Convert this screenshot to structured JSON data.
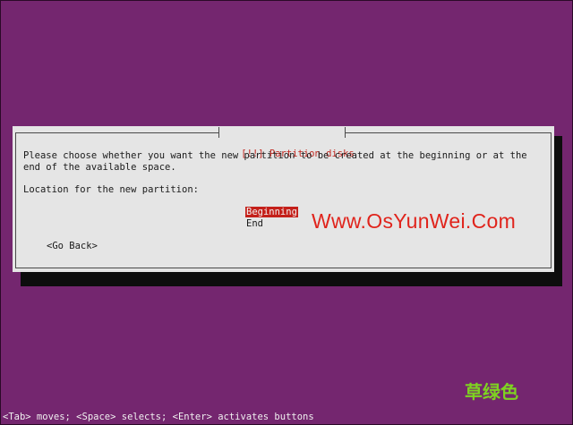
{
  "dialog": {
    "title": "[!!] Partition disks",
    "prompt_line1": "Please choose whether you want the new partition to be created at the beginning or at the",
    "prompt_line2": "end of the available space.",
    "location_label": "Location for the new partition:",
    "options": [
      {
        "label": "Beginning",
        "selected": true
      },
      {
        "label": "End",
        "selected": false
      }
    ],
    "go_back_label": "<Go Back>"
  },
  "watermark": {
    "site": "Www.OsYunWei.Com",
    "cn_text": "草绿色"
  },
  "status_bar": {
    "text": "<Tab> moves; <Space> selects; <Enter> activates buttons"
  },
  "colors": {
    "background": "#74266f",
    "dialog_bg": "#e5e5e5",
    "title_text": "#c0271f",
    "selected_bg": "#c4201a",
    "watermark_red": "#e0241c",
    "watermark_green": "#7ed321"
  }
}
